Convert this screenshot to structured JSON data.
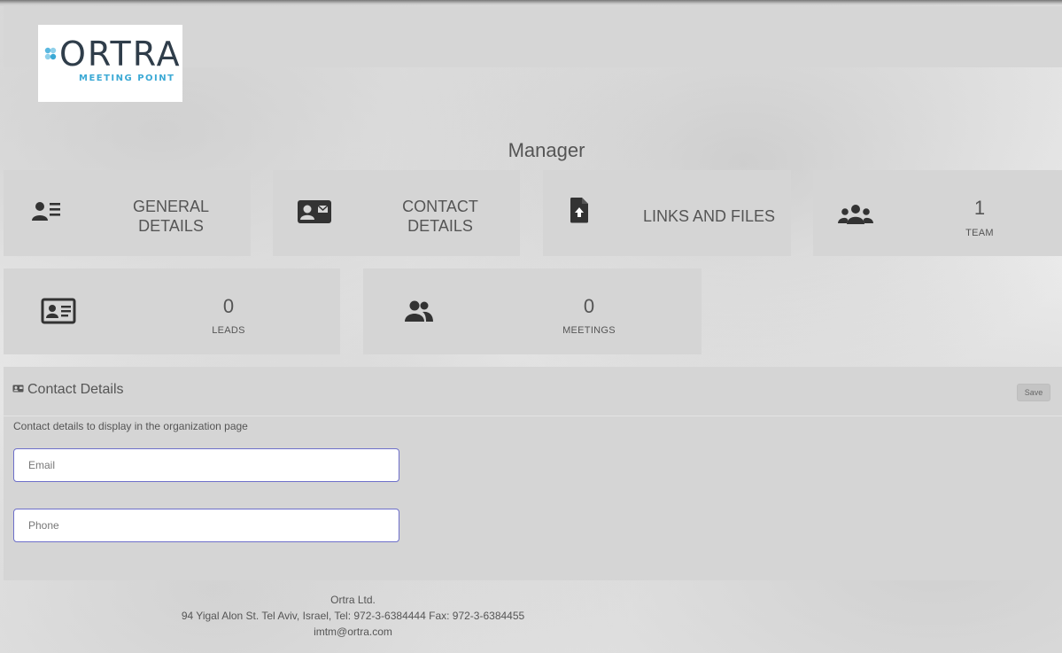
{
  "logo": {
    "wordmark": "ORTRA",
    "tagline": "MEETING POINT"
  },
  "page": {
    "title": "Manager"
  },
  "cards": {
    "general": {
      "line1": "GENERAL",
      "line2": "DETAILS"
    },
    "contact": {
      "line1": "CONTACT",
      "line2": "DETAILS"
    },
    "links": {
      "label": "LINKS AND FILES"
    },
    "team": {
      "count": "1",
      "label": "TEAM"
    },
    "leads": {
      "count": "0",
      "label": "LEADS"
    },
    "meetings": {
      "count": "0",
      "label": "MEETINGS"
    }
  },
  "panel": {
    "title": "Contact Details",
    "save_label": "Save",
    "description": "Contact details to display in the organization page",
    "email_placeholder": "Email",
    "phone_placeholder": "Phone",
    "email_value": "",
    "phone_value": ""
  },
  "footer": {
    "company": "Ortra Ltd.",
    "address": "94 Yigal Alon St. Tel Aviv, Israel, Tel: 972-3-6384444 Fax: 972-3-6384455",
    "email": "imtm@ortra.com"
  },
  "colors": {
    "card_bg": "#d5d5d5",
    "icon": "#333333",
    "input_border": "#6d6fc9",
    "logo_text": "#2f3d4a",
    "logo_accent": "#3ba9d5"
  },
  "icons": {
    "general": "user-list-icon",
    "contact": "contact-card-icon",
    "links": "file-upload-icon",
    "team": "team-icon",
    "leads": "id-card-icon",
    "meetings": "users-icon",
    "panel": "contact-card-icon"
  }
}
